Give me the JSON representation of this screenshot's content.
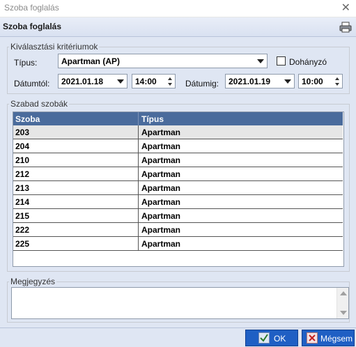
{
  "window": {
    "title": "Szoba foglalás"
  },
  "header": {
    "title": "Szoba foglalás"
  },
  "criteria": {
    "legend": "Kiválasztási kritériumok",
    "type_label": "Típus:",
    "type_value": "Apartman (AP)",
    "smoker_label": "Dohányzó",
    "smoker_checked": false,
    "from_label": "Dátumtól:",
    "from_date": "2021.01.18",
    "from_time": "14:00",
    "to_label": "Dátumig:",
    "to_date": "2021.01.19",
    "to_time": "10:00"
  },
  "rooms": {
    "legend": "Szabad szobák",
    "columns": [
      "Szoba",
      "Típus"
    ],
    "rows": [
      [
        "203",
        "Apartman"
      ],
      [
        "204",
        "Apartman"
      ],
      [
        "210",
        "Apartman"
      ],
      [
        "212",
        "Apartman"
      ],
      [
        "213",
        "Apartman"
      ],
      [
        "214",
        "Apartman"
      ],
      [
        "215",
        "Apartman"
      ],
      [
        "222",
        "Apartman"
      ],
      [
        "225",
        "Apartman"
      ]
    ]
  },
  "notes": {
    "legend": "Megjegyzés",
    "value": ""
  },
  "buttons": {
    "ok": "OK",
    "cancel": "Mégsem"
  },
  "colors": {
    "header_blue": "#4a6b9c",
    "button_blue": "#1f5fc4",
    "panel": "#dfe6f3"
  },
  "icons": [
    "close-icon",
    "printer-icon",
    "checkmark-icon",
    "cancel-x-icon"
  ]
}
